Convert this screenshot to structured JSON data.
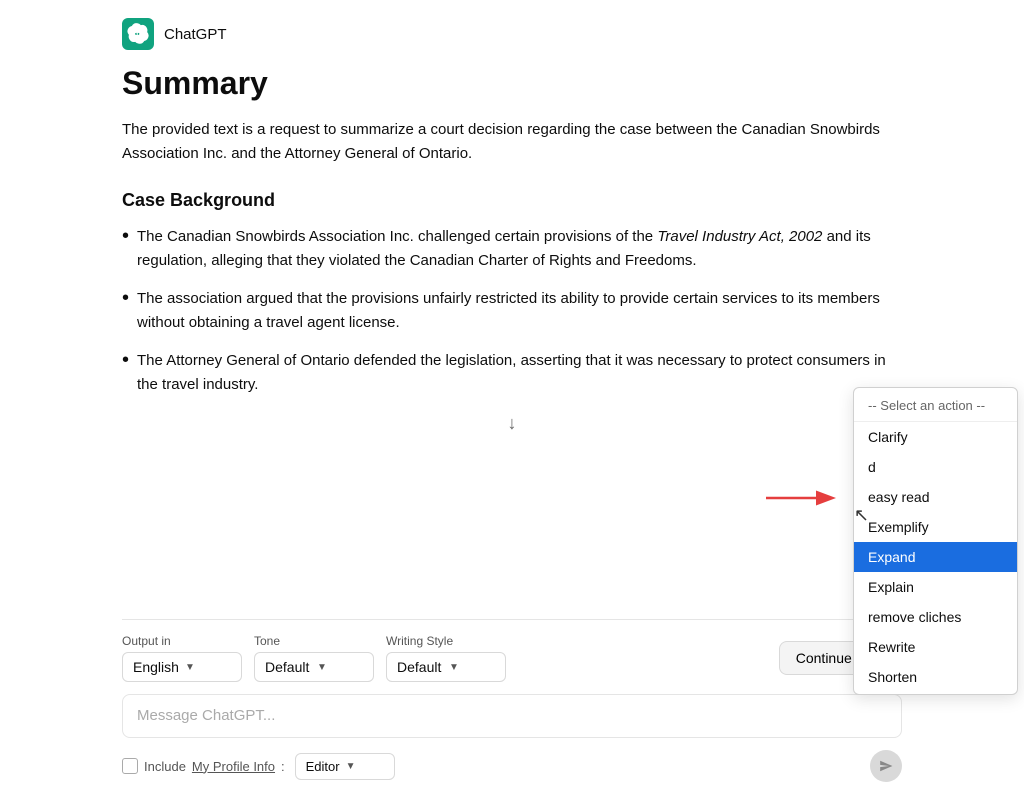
{
  "header": {
    "app_name": "ChatGPT",
    "logo_alt": "ChatGPT logo"
  },
  "main": {
    "title": "Summary",
    "intro": "The provided text is a request to summarize a court decision regarding the case between the Canadian Snowbirds Association Inc. and the Attorney General of Ontario.",
    "section_title": "Case Background",
    "bullets": [
      {
        "text": "The Canadian Snowbirds Association Inc. challenged certain provisions of the Travel Industry Act, 2002 and its regulation, alleging that they violated the Canadian Charter of Rights and Freedoms.",
        "italic_part": "Travel Industry Act, 2002"
      },
      {
        "text": "The association argued that the provisions unfairly restricted its ability to provide certain services to its members without obtaining a travel agent license."
      },
      {
        "text": "The Attorney General of Ontario defended the legislation, asserting that it was necessary to protect consumers in the travel industry."
      }
    ]
  },
  "toolbar": {
    "output_label": "Output in",
    "output_value": "English",
    "tone_label": "Tone",
    "tone_value": "Default",
    "writing_style_label": "Writing Style",
    "writing_style_value": "Default",
    "continue_label": "Continue"
  },
  "message_input": {
    "placeholder": "Message ChatGPT..."
  },
  "bottom_row": {
    "include_label": "Include",
    "profile_link": "My Profile Info",
    "colon": ":",
    "editor_value": "Editor"
  },
  "dropdown": {
    "header": "-- Select an action --",
    "items": [
      {
        "label": "Clarify",
        "selected": false
      },
      {
        "label": "d",
        "selected": false
      },
      {
        "label": "easy read",
        "selected": false
      },
      {
        "label": "Exemplify",
        "selected": false
      },
      {
        "label": "Expand",
        "selected": true
      },
      {
        "label": "Explain",
        "selected": false
      },
      {
        "label": "remove cliches",
        "selected": false
      },
      {
        "label": "Rewrite",
        "selected": false
      },
      {
        "label": "Shorten",
        "selected": false
      }
    ]
  }
}
